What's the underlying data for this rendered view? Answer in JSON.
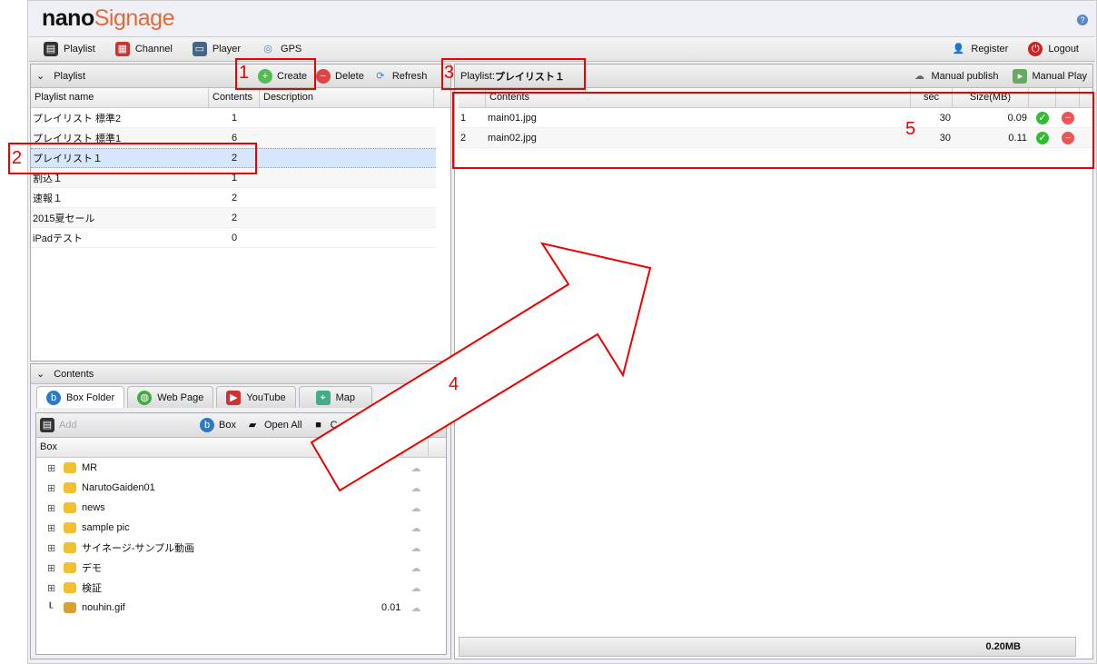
{
  "app": {
    "logo_bold": "nano",
    "logo_light": "Signage"
  },
  "nav": {
    "items": [
      {
        "label": "Playlist"
      },
      {
        "label": "Channel"
      },
      {
        "label": "Player"
      },
      {
        "label": "GPS"
      }
    ],
    "register": "Register",
    "logout": "Logout"
  },
  "playlist_panel": {
    "title": "Playlist",
    "create": "Create",
    "delete": "Delete",
    "refresh": "Refresh",
    "columns": [
      "Playlist name",
      "Contents",
      "Description"
    ],
    "rows": [
      {
        "name": "プレイリスト 標準2",
        "contents": "1"
      },
      {
        "name": "プレイリスト 標準1",
        "contents": "6"
      },
      {
        "name": "プレイリスト１",
        "contents": "2",
        "selected": true
      },
      {
        "name": "割込１",
        "contents": "1"
      },
      {
        "name": "速報１",
        "contents": "2"
      },
      {
        "name": "2015夏セール",
        "contents": "2"
      },
      {
        "name": "iPadテスト",
        "contents": "0"
      }
    ]
  },
  "contents_panel": {
    "title": "Contents",
    "tabs": [
      "Box Folder",
      "Web Page",
      "YouTube",
      "Map"
    ],
    "add": "Add",
    "box": "Box",
    "open_all": "Open All",
    "close_all": "C",
    "column": "Box",
    "tree": [
      {
        "name": "MR",
        "type": "folder"
      },
      {
        "name": "NarutoGaiden01",
        "type": "folder"
      },
      {
        "name": "news",
        "type": "folder"
      },
      {
        "name": "sample pic",
        "type": "folder"
      },
      {
        "name": "サイネージ-サンプル動画",
        "type": "folder"
      },
      {
        "name": "デモ",
        "type": "folder"
      },
      {
        "name": "検証",
        "type": "folder"
      },
      {
        "name": "nouhin.gif",
        "type": "file",
        "size": "0.01"
      }
    ]
  },
  "detail_panel": {
    "label": "Playlist:",
    "name": "プレイリスト１",
    "manual_publish": "Manual publish",
    "manual_play": "Manual Play",
    "columns": [
      "Contents",
      "sec",
      "Size(MB)"
    ],
    "rows": [
      {
        "n": "1",
        "file": "main01.jpg",
        "sec": "30",
        "size": "0.09"
      },
      {
        "n": "2",
        "file": "main02.jpg",
        "sec": "30",
        "size": "0.11"
      }
    ],
    "total": "0.20MB"
  },
  "annotations": [
    "1",
    "2",
    "3",
    "4",
    "5"
  ],
  "colors": {
    "annotation": "#ee0000",
    "selected_row": "#d6e6fb",
    "logo_accent": "#e06b3a"
  }
}
